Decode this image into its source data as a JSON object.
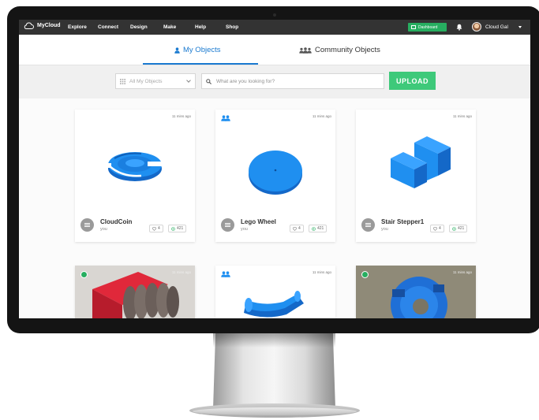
{
  "topnav": {
    "brand": "MyCloud",
    "items": [
      {
        "label": "Explore"
      },
      {
        "label": "Connect"
      },
      {
        "label": "Design"
      },
      {
        "label": "Make"
      },
      {
        "label": "Help"
      },
      {
        "label": "Shop"
      }
    ],
    "dashboard_label": "Dashboard",
    "user_name": "Cloud Gal",
    "icons": [
      "cloud-logo-icon",
      "dashboard-icon",
      "bell-icon",
      "avatar",
      "caret-down-icon"
    ]
  },
  "tabs": [
    {
      "label": "My Objects",
      "active": true,
      "icon": "person-icon"
    },
    {
      "label": "Community Objects",
      "active": false,
      "icon": "people-icon"
    }
  ],
  "search": {
    "filter_value": "All My Objects",
    "placeholder": "What are you looking for?",
    "upload_label": "UPLOAD"
  },
  "cards": [
    {
      "title": "CloudCoin",
      "owner": "you",
      "time": "11 mins ago",
      "likes": "4",
      "views": "421",
      "shared": false
    },
    {
      "title": "Lego Wheel",
      "owner": "you",
      "time": "11 mins ago",
      "likes": "4",
      "views": "421",
      "shared": true
    },
    {
      "title": "Stair Stepper1",
      "owner": "you",
      "time": "11 mins ago",
      "likes": "4",
      "views": "421",
      "shared": false
    },
    {
      "title": "",
      "owner": "",
      "time": "11 mins ago",
      "shared": false,
      "public": true
    },
    {
      "title": "",
      "owner": "",
      "time": "11 mins ago",
      "shared": true
    },
    {
      "title": "",
      "owner": "",
      "time": "11 mins ago",
      "shared": false,
      "public": true
    }
  ],
  "colors": {
    "topbar": "#333333",
    "accent_blue": "#1a7ad0",
    "upload_green": "#3ec97a",
    "dashboard_green": "#27ae60",
    "model_blue": "#1f8ff0"
  }
}
